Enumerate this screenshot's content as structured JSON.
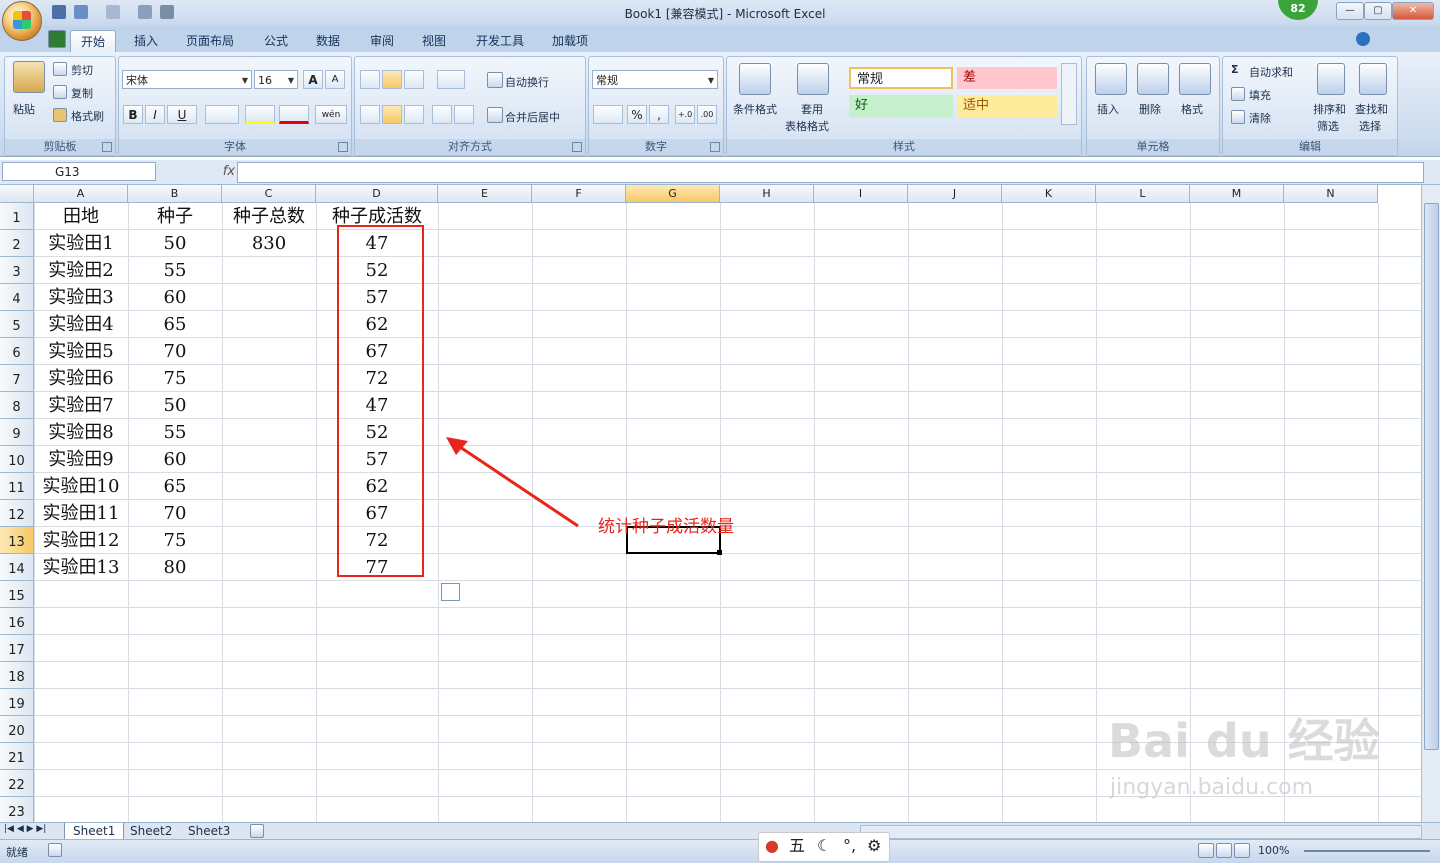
{
  "window": {
    "title": "Book1  [兼容模式] - Microsoft Excel",
    "badge": "82",
    "min": "—",
    "max": "▢",
    "close": "✕"
  },
  "tabs": [
    "开始",
    "插入",
    "页面布局",
    "公式",
    "数据",
    "审阅",
    "视图",
    "开发工具",
    "加载项"
  ],
  "clipboard": {
    "paste": "粘贴",
    "cut": "剪切",
    "copy": "复制",
    "format_painter": "格式刷",
    "label": "剪贴板"
  },
  "font": {
    "name": "宋体",
    "size": "16",
    "grow": "A",
    "shrink": "A",
    "bold": "B",
    "italic": "I",
    "underline": "U",
    "phonetic": "wén",
    "label": "字体"
  },
  "alignment": {
    "wrap": "自动换行",
    "merge": "合并后居中",
    "label": "对齐方式"
  },
  "number": {
    "format": "常规",
    "percent": "%",
    "comma": ",",
    "inc_decimal": "+.0",
    "dec_decimal": ".00",
    "label": "数字"
  },
  "styles": {
    "conditional": "条件格式",
    "table": "套用",
    "table2": "表格格式",
    "normal": "常规",
    "bad": "差",
    "good": "好",
    "neutral": "适中",
    "label": "样式",
    "colors": {
      "bad_bg": "#ffc7ce",
      "bad_fg": "#9c0006",
      "good_bg": "#c6efce",
      "good_fg": "#006100",
      "neutral_bg": "#ffeb9c",
      "neutral_fg": "#9c5700"
    }
  },
  "cells_group": {
    "insert": "插入",
    "delete": "删除",
    "format": "格式",
    "label": "单元格"
  },
  "editing": {
    "autosum": "自动求和",
    "fill": "填充",
    "clear": "清除",
    "sort": "排序和",
    "sort2": "筛选",
    "find": "查找和",
    "find2": "选择",
    "label": "编辑"
  },
  "formula_bar": {
    "name_box": "G13",
    "fx": "fx",
    "value": ""
  },
  "columns": [
    "A",
    "B",
    "C",
    "D",
    "E",
    "F",
    "G",
    "H",
    "I",
    "J",
    "K",
    "L",
    "M",
    "N"
  ],
  "rows": [
    "1",
    "2",
    "3",
    "4",
    "5",
    "6",
    "7",
    "8",
    "9",
    "10",
    "11",
    "12",
    "13",
    "14",
    "15",
    "16",
    "17",
    "18",
    "19",
    "20",
    "21",
    "22",
    "23"
  ],
  "sheet": {
    "headers": [
      "田地",
      "种子",
      "种子总数",
      "种子成活数"
    ],
    "total": "830",
    "data": [
      [
        "实验田1",
        "50",
        "47"
      ],
      [
        "实验田2",
        "55",
        "52"
      ],
      [
        "实验田3",
        "60",
        "57"
      ],
      [
        "实验田4",
        "65",
        "62"
      ],
      [
        "实验田5",
        "70",
        "67"
      ],
      [
        "实验田6",
        "75",
        "72"
      ],
      [
        "实验田7",
        "50",
        "47"
      ],
      [
        "实验田8",
        "55",
        "52"
      ],
      [
        "实验田9",
        "60",
        "57"
      ],
      [
        "实验田10",
        "65",
        "62"
      ],
      [
        "实验田11",
        "70",
        "67"
      ],
      [
        "实验田12",
        "75",
        "72"
      ],
      [
        "实验田13",
        "80",
        "77"
      ]
    ]
  },
  "annotation": {
    "text": "统计种子成活数量",
    "color": "#e8251a"
  },
  "sheet_tabs": [
    "Sheet1",
    "Sheet2",
    "Sheet3"
  ],
  "status": {
    "ready": "就绪",
    "zoom": "100%",
    "ime": "五",
    "watermark": "Bai du 经验",
    "watermark_url": "jingyan.baidu.com"
  }
}
